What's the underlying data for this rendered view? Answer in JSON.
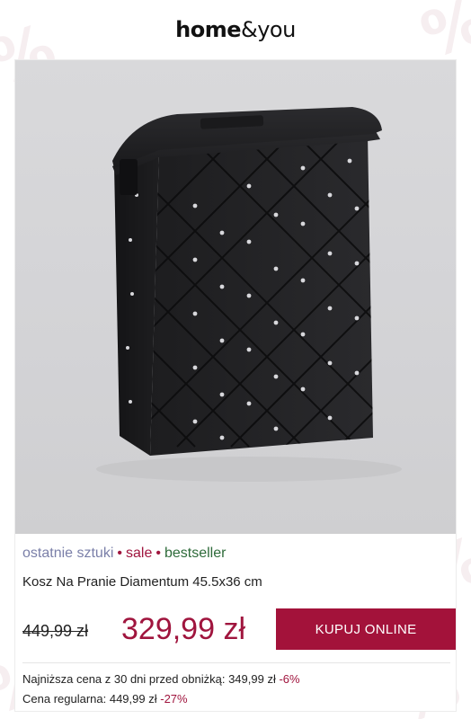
{
  "brand": {
    "name_bold": "home",
    "name_light": "&you"
  },
  "product": {
    "tags": [
      "ostatnie sztuki",
      "sale",
      "bestseller"
    ],
    "tag_separator": "•",
    "title": "Kosz Na Pranie Diamentum 45.5x36 cm",
    "old_price": "449,99 zł",
    "new_price": "329,99 zł",
    "buy_button": "KUPUJ ONLINE",
    "lowest_price_label": "Najniższa cena z 30 dni przed obniżką: 349,99 zł",
    "lowest_price_discount": "-6%",
    "regular_price_label": "Cena regularna: 449,99 zł",
    "regular_price_discount": "-27%"
  },
  "colors": {
    "accent": "#a3123a",
    "sale_tag": "#a0153e",
    "bestseller_tag": "#2e6b3a",
    "last_items_tag": "#7a7fa8"
  },
  "background_glyph": "%"
}
